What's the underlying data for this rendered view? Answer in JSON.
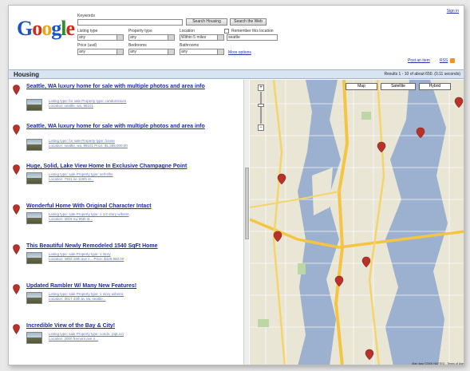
{
  "header": {
    "logo": "Google",
    "keywords_label": "Keywords",
    "keywords_value": "",
    "search_housing_btn": "Search Housing",
    "search_web_btn": "Search the Web",
    "listing_type_label": "Listing type",
    "listing_type_value": "any",
    "property_type_label": "Property type",
    "property_type_value": "any",
    "location_label": "Location",
    "remember_label": "Remember this location",
    "within_value": "Within 5 miles",
    "location_value": "seattle",
    "price_label": "Price (usd)",
    "price_value": "any",
    "bedrooms_label": "Bedrooms",
    "bedrooms_value": "any",
    "bathrooms_label": "Bathrooms",
    "bathrooms_value": "any",
    "more_options": "More options",
    "sign_in": "Sign in",
    "post_item": "Post an item",
    "rss": "RSS"
  },
  "bar": {
    "title": "Housing",
    "results": "Results 1 - 10 of about 650. (0.11 seconds)"
  },
  "listings": [
    {
      "title": "Seattle, WA luxury home for sale with multiple photos and area info",
      "meta1": "Listing type: for sale    Property type: condominium",
      "meta2": "Location: seattle, wa, 98101"
    },
    {
      "title": "Seattle, WA luxury home for sale with multiple photos and area info",
      "meta1": "Listing type: for sale    Property type: house",
      "meta2": "Location: seattle, wa, 98101    Price: $1,395,000.00"
    },
    {
      "title": "Huge, Solid, Lake View Home In Exclusive Champagne Point",
      "meta1": "Listing type: sale    Property type: sell-sfhs",
      "meta2": "Location: 7321 ne 116th st..."
    },
    {
      "title": "Wonderful Home With Original Character Intact",
      "meta1": "Listing type: sale    Property type: 1 1/2 story w/bsmt",
      "meta2": "Location: 3018 nw 65th st..."
    },
    {
      "title": "This Beautiful Newly Remodeled 1540 SqFt Home",
      "meta1": "Listing type: sale    Property type: 1 story",
      "meta2": "Location: 3903 19th ave s...    Price: $429,950.00"
    },
    {
      "title": "Updated Rambler W/ Many New Features!",
      "meta1": "Listing type: sale    Property type: 1 story w/bsmt.",
      "meta2": "Location: 3017 43th av sw, seattle..."
    },
    {
      "title": "Incredible View of the Bay & City!",
      "meta1": "Listing type: sale    Property type: condo, (apt.co)",
      "meta2": "Location: 2000 fremont ave n..."
    }
  ],
  "map": {
    "btn_map": "Map",
    "btn_satellite": "Satellite",
    "btn_hybrid": "Hybrid",
    "zoom_in": "+",
    "zoom_out": "−",
    "legal": "Map data ©2006 NAVTEQ - Terms of Use"
  },
  "colors": {
    "link": "#1b2ab0",
    "bar": "#d9e4f3",
    "water": "#9bb1cf",
    "pin": "#b9322a"
  }
}
